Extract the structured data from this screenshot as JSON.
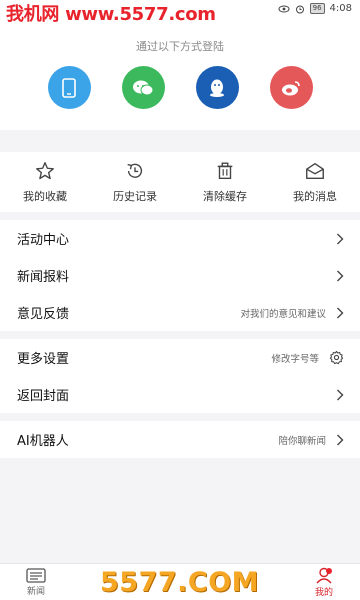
{
  "status": {
    "watermark": "我机网 www.5577.com",
    "battery": "96",
    "time": "4:08"
  },
  "login": {
    "hint": "通过以下方式登陆",
    "methods": [
      {
        "name": "phone-icon",
        "color": "#3ba3e8"
      },
      {
        "name": "wechat-icon",
        "color": "#3cb95c"
      },
      {
        "name": "qq-icon",
        "color": "#1a5fb4"
      },
      {
        "name": "weibo-icon",
        "color": "#e4585a"
      }
    ]
  },
  "quick": {
    "items": [
      {
        "label": "我的收藏",
        "icon": "star-icon"
      },
      {
        "label": "历史记录",
        "icon": "history-icon"
      },
      {
        "label": "清除缓存",
        "icon": "trash-icon"
      },
      {
        "label": "我的消息",
        "icon": "envelope-icon"
      }
    ]
  },
  "menu": {
    "activity": "活动中心",
    "news_tip": "新闻报料",
    "feedback": "意见反馈",
    "feedback_hint": "对我们的意见和建议",
    "settings": "更多设置",
    "settings_hint": "修改字号等",
    "back_cover": "返回封面",
    "ai": "AI机器人",
    "ai_hint": "陪你聊新闻"
  },
  "nav": {
    "items": [
      {
        "label": "新闻"
      },
      {
        "label": ""
      },
      {
        "label": ""
      },
      {
        "label": ""
      },
      {
        "label": "我的"
      }
    ]
  },
  "watermark_bottom": "5577.COM",
  "colors": {
    "accent": "#d6232b",
    "background": "#f4f4f6"
  }
}
